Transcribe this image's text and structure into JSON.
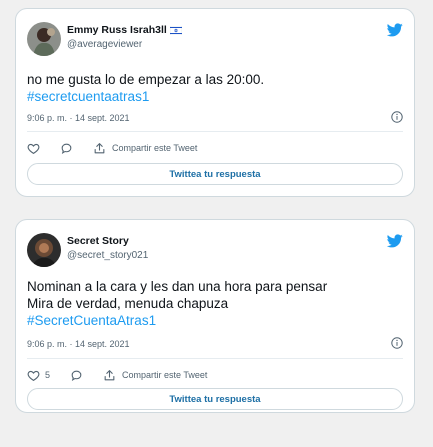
{
  "colors": {
    "link": "#1d9bf0",
    "brand": "#1d9bf0",
    "muted": "#536471",
    "text": "#0f1419"
  },
  "tweets": [
    {
      "display_name": "Emmy Russ Israh3ll",
      "flag_icon": "israel-flag-icon",
      "handle": "@averageviewer",
      "text_lines": [
        "no me gusta lo de empezar a las 20:00."
      ],
      "hashtags": [
        "#secretcuentaatras1"
      ],
      "timestamp": "9:06 p. m. · 14 sept. 2021",
      "like_count": "",
      "share_label": "Compartir este Tweet",
      "reply_label": "Twittea tu respuesta"
    },
    {
      "display_name": "Secret Story",
      "handle": "@secret_story021",
      "text_lines": [
        "Nominan a la cara y les dan una hora para pensar",
        "Mira de verdad, menuda chapuza"
      ],
      "hashtags": [
        "#SecretCuentaAtras1"
      ],
      "timestamp": "9:06 p. m. · 14 sept. 2021",
      "like_count": "5",
      "share_label": "Compartir este Tweet",
      "reply_label": "Twittea tu respuesta"
    }
  ]
}
